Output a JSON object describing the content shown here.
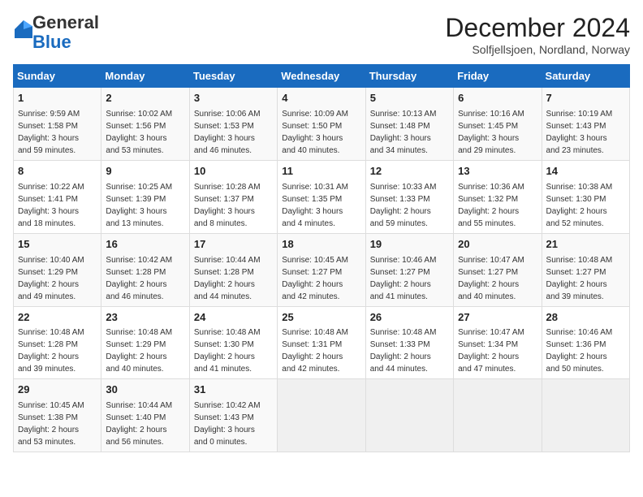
{
  "header": {
    "logo_general": "General",
    "logo_blue": "Blue",
    "month_title": "December 2024",
    "subtitle": "Solfjellsjoen, Nordland, Norway"
  },
  "days_of_week": [
    "Sunday",
    "Monday",
    "Tuesday",
    "Wednesday",
    "Thursday",
    "Friday",
    "Saturday"
  ],
  "weeks": [
    [
      {
        "day": "1",
        "info": "Sunrise: 9:59 AM\nSunset: 1:58 PM\nDaylight: 3 hours\nand 59 minutes."
      },
      {
        "day": "2",
        "info": "Sunrise: 10:02 AM\nSunset: 1:56 PM\nDaylight: 3 hours\nand 53 minutes."
      },
      {
        "day": "3",
        "info": "Sunrise: 10:06 AM\nSunset: 1:53 PM\nDaylight: 3 hours\nand 46 minutes."
      },
      {
        "day": "4",
        "info": "Sunrise: 10:09 AM\nSunset: 1:50 PM\nDaylight: 3 hours\nand 40 minutes."
      },
      {
        "day": "5",
        "info": "Sunrise: 10:13 AM\nSunset: 1:48 PM\nDaylight: 3 hours\nand 34 minutes."
      },
      {
        "day": "6",
        "info": "Sunrise: 10:16 AM\nSunset: 1:45 PM\nDaylight: 3 hours\nand 29 minutes."
      },
      {
        "day": "7",
        "info": "Sunrise: 10:19 AM\nSunset: 1:43 PM\nDaylight: 3 hours\nand 23 minutes."
      }
    ],
    [
      {
        "day": "8",
        "info": "Sunrise: 10:22 AM\nSunset: 1:41 PM\nDaylight: 3 hours\nand 18 minutes."
      },
      {
        "day": "9",
        "info": "Sunrise: 10:25 AM\nSunset: 1:39 PM\nDaylight: 3 hours\nand 13 minutes."
      },
      {
        "day": "10",
        "info": "Sunrise: 10:28 AM\nSunset: 1:37 PM\nDaylight: 3 hours\nand 8 minutes."
      },
      {
        "day": "11",
        "info": "Sunrise: 10:31 AM\nSunset: 1:35 PM\nDaylight: 3 hours\nand 4 minutes."
      },
      {
        "day": "12",
        "info": "Sunrise: 10:33 AM\nSunset: 1:33 PM\nDaylight: 2 hours\nand 59 minutes."
      },
      {
        "day": "13",
        "info": "Sunrise: 10:36 AM\nSunset: 1:32 PM\nDaylight: 2 hours\nand 55 minutes."
      },
      {
        "day": "14",
        "info": "Sunrise: 10:38 AM\nSunset: 1:30 PM\nDaylight: 2 hours\nand 52 minutes."
      }
    ],
    [
      {
        "day": "15",
        "info": "Sunrise: 10:40 AM\nSunset: 1:29 PM\nDaylight: 2 hours\nand 49 minutes."
      },
      {
        "day": "16",
        "info": "Sunrise: 10:42 AM\nSunset: 1:28 PM\nDaylight: 2 hours\nand 46 minutes."
      },
      {
        "day": "17",
        "info": "Sunrise: 10:44 AM\nSunset: 1:28 PM\nDaylight: 2 hours\nand 44 minutes."
      },
      {
        "day": "18",
        "info": "Sunrise: 10:45 AM\nSunset: 1:27 PM\nDaylight: 2 hours\nand 42 minutes."
      },
      {
        "day": "19",
        "info": "Sunrise: 10:46 AM\nSunset: 1:27 PM\nDaylight: 2 hours\nand 41 minutes."
      },
      {
        "day": "20",
        "info": "Sunrise: 10:47 AM\nSunset: 1:27 PM\nDaylight: 2 hours\nand 40 minutes."
      },
      {
        "day": "21",
        "info": "Sunrise: 10:48 AM\nSunset: 1:27 PM\nDaylight: 2 hours\nand 39 minutes."
      }
    ],
    [
      {
        "day": "22",
        "info": "Sunrise: 10:48 AM\nSunset: 1:28 PM\nDaylight: 2 hours\nand 39 minutes."
      },
      {
        "day": "23",
        "info": "Sunrise: 10:48 AM\nSunset: 1:29 PM\nDaylight: 2 hours\nand 40 minutes."
      },
      {
        "day": "24",
        "info": "Sunrise: 10:48 AM\nSunset: 1:30 PM\nDaylight: 2 hours\nand 41 minutes."
      },
      {
        "day": "25",
        "info": "Sunrise: 10:48 AM\nSunset: 1:31 PM\nDaylight: 2 hours\nand 42 minutes."
      },
      {
        "day": "26",
        "info": "Sunrise: 10:48 AM\nSunset: 1:33 PM\nDaylight: 2 hours\nand 44 minutes."
      },
      {
        "day": "27",
        "info": "Sunrise: 10:47 AM\nSunset: 1:34 PM\nDaylight: 2 hours\nand 47 minutes."
      },
      {
        "day": "28",
        "info": "Sunrise: 10:46 AM\nSunset: 1:36 PM\nDaylight: 2 hours\nand 50 minutes."
      }
    ],
    [
      {
        "day": "29",
        "info": "Sunrise: 10:45 AM\nSunset: 1:38 PM\nDaylight: 2 hours\nand 53 minutes."
      },
      {
        "day": "30",
        "info": "Sunrise: 10:44 AM\nSunset: 1:40 PM\nDaylight: 2 hours\nand 56 minutes."
      },
      {
        "day": "31",
        "info": "Sunrise: 10:42 AM\nSunset: 1:43 PM\nDaylight: 3 hours\nand 0 minutes."
      },
      {
        "day": "",
        "info": ""
      },
      {
        "day": "",
        "info": ""
      },
      {
        "day": "",
        "info": ""
      },
      {
        "day": "",
        "info": ""
      }
    ]
  ]
}
